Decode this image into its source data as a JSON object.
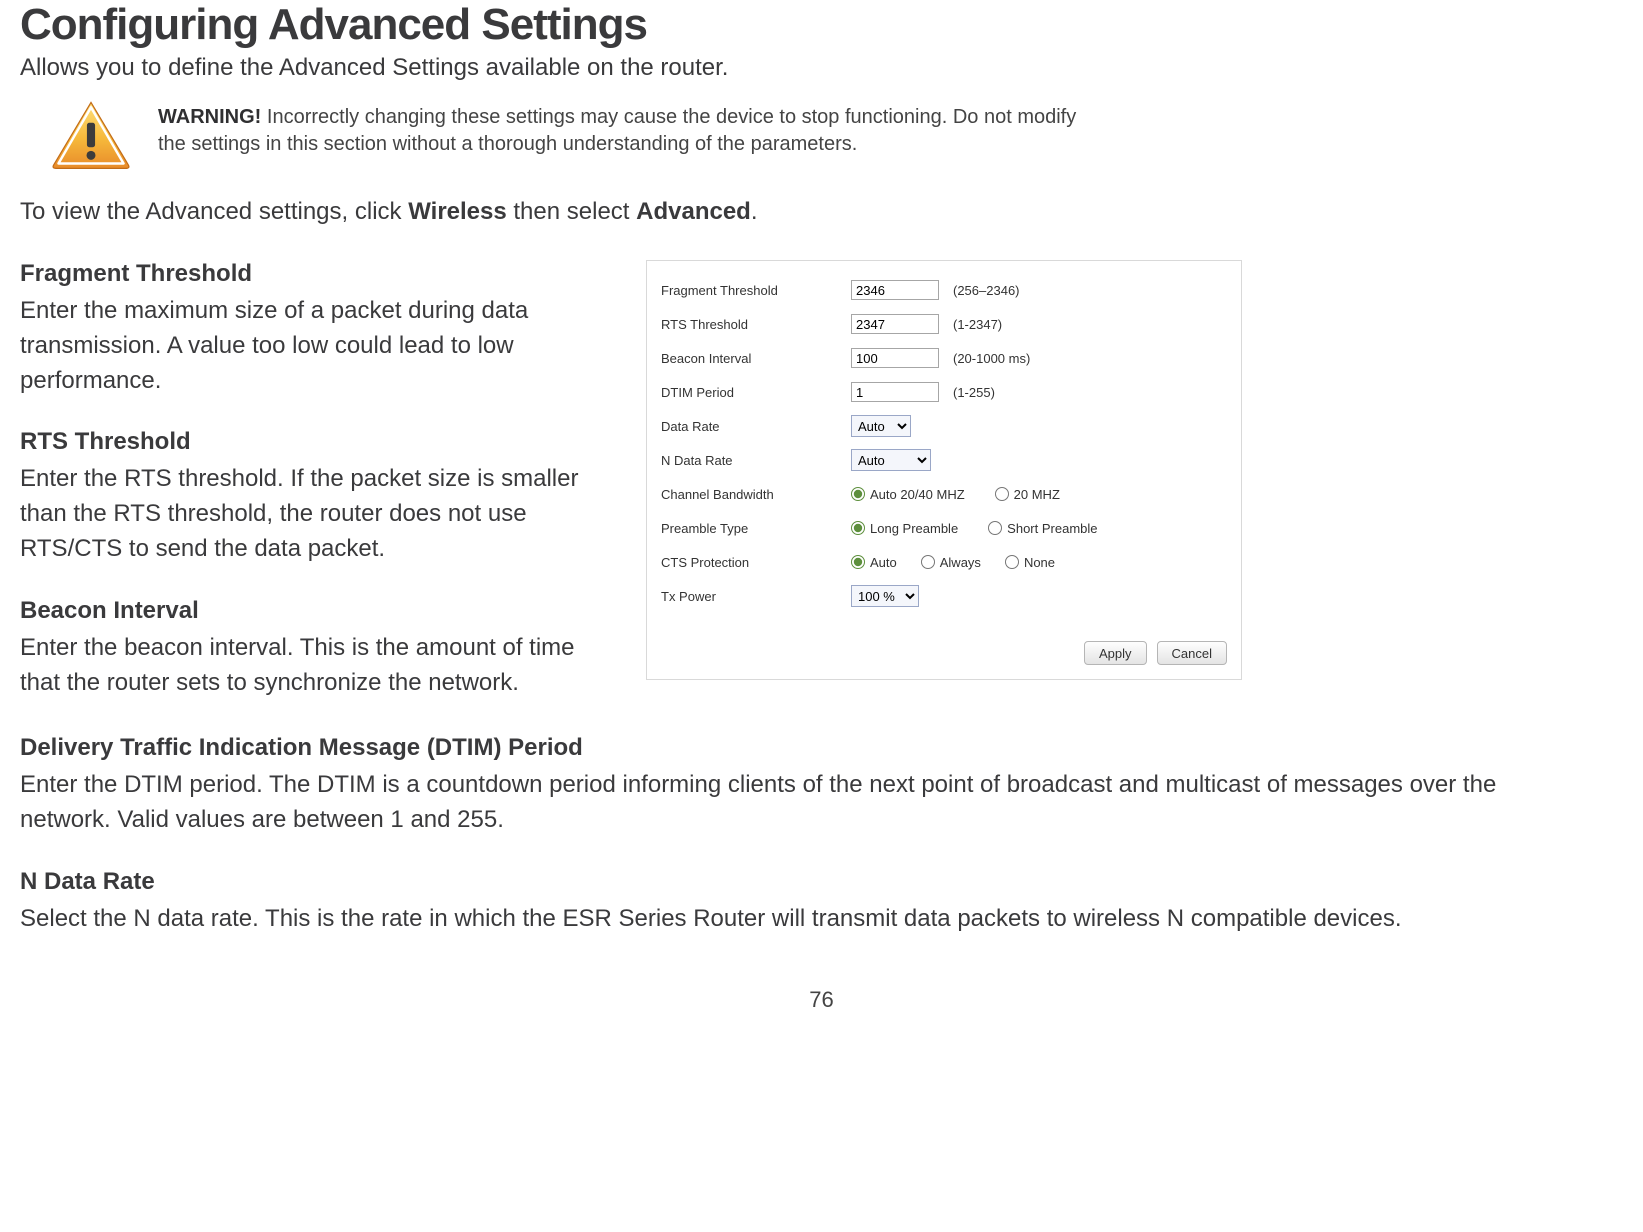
{
  "title": "Configuring Advanced Settings",
  "subtitle": "Allows you to define the Advanced Settings available on the router.",
  "warning": {
    "label": "WARNING!",
    "text": "Incorrectly changing these settings may cause the device to stop functioning. Do not modify the settings in this section without a thorough understanding of the parameters."
  },
  "instruction": {
    "prefix": "To view the Advanced settings, click ",
    "bold1": "Wireless",
    "mid": " then select ",
    "bold2": "Advanced",
    "suffix": "."
  },
  "sections": {
    "fragment": {
      "heading": "Fragment Threshold",
      "body": "Enter the maximum size of a packet during data transmission. A value too low could lead to low performance."
    },
    "rts": {
      "heading": "RTS Threshold",
      "body": "Enter the RTS threshold. If the packet size is smaller than the RTS threshold, the router does not use RTS/CTS to send the data packet."
    },
    "beacon": {
      "heading": "Beacon Interval",
      "body": "Enter the beacon interval. This is the amount of time that the router sets to synchronize the network."
    },
    "dtim": {
      "heading": "Delivery Traffic Indication Message (DTIM) Period",
      "body": "Enter the DTIM period. The DTIM is a countdown period informing clients of the next point of broadcast and multicast of messages over the network. Valid values are between 1 and 255."
    },
    "ndata": {
      "heading": "N Data Rate",
      "body": "Select the N data rate. This is the rate in which the ESR Series Router will transmit data packets to wireless N compatible devices."
    }
  },
  "panel": {
    "fragment": {
      "label": "Fragment Threshold",
      "value": "2346",
      "hint": "(256–2346)"
    },
    "rts": {
      "label": "RTS Threshold",
      "value": "2347",
      "hint": "(1-2347)"
    },
    "beacon": {
      "label": "Beacon Interval",
      "value": "100",
      "hint": "(20-1000 ms)"
    },
    "dtim_p": {
      "label": "DTIM Period",
      "value": "1",
      "hint": "(1-255)"
    },
    "data_rate": {
      "label": "Data Rate",
      "value": "Auto"
    },
    "n_data_rate": {
      "label": "N Data Rate",
      "value": "Auto"
    },
    "chbw": {
      "label": "Channel Bandwidth",
      "opt1": "Auto 20/40 MHZ",
      "opt2": "20 MHZ"
    },
    "preamble": {
      "label": "Preamble Type",
      "opt1": "Long Preamble",
      "opt2": "Short Preamble"
    },
    "cts": {
      "label": "CTS Protection",
      "opt1": "Auto",
      "opt2": "Always",
      "opt3": "None"
    },
    "tx": {
      "label": "Tx Power",
      "value": "100 %"
    },
    "buttons": {
      "apply": "Apply",
      "cancel": "Cancel"
    }
  },
  "page_number": "76"
}
